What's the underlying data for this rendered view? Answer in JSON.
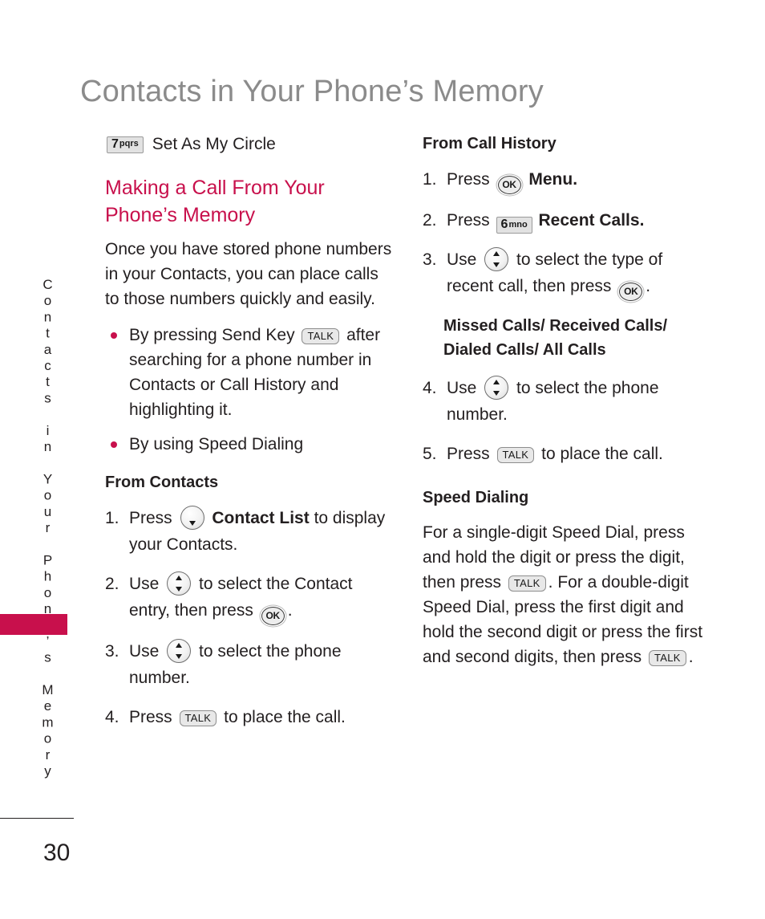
{
  "page": {
    "title": "Contacts in Your Phone’s Memory",
    "side_tab_text": "Contacts in Your Phone’s Memory",
    "folio": "30",
    "accent_color": "#c8104c",
    "title_color": "#8b8b8b",
    "text_color": "#231f20"
  },
  "left_column": {
    "menu_item": {
      "key_digit": "7",
      "key_letters": "pqrs",
      "label": "Set As My Circle"
    },
    "heading": "Making a Call From Your Phone’s Memory",
    "intro": "Once you have stored phone numbers in your Contacts, you can place calls to those numbers quickly and easily.",
    "bullets": [
      {
        "pre": "By pressing Send Key",
        "key": "TALK",
        "post": "after searching for a phone number in Contacts or Call History and highlighting it."
      },
      {
        "pre": "By using Speed Dialing",
        "key": "",
        "post": ""
      }
    ],
    "subhead": "From Contacts",
    "steps": [
      {
        "num": "1.",
        "pre": "Press",
        "key": "nav-down",
        "bold": "Contact List",
        "post": "to display your Contacts."
      },
      {
        "num": "2.",
        "pre": "Use",
        "key": "nav-updown",
        "bold": "",
        "post": "to select the Contact entry, then press",
        "key2": "OK",
        "tail": "."
      },
      {
        "num": "3.",
        "pre": "Use",
        "key": "nav-updown",
        "bold": "",
        "post": "to select the phone number."
      },
      {
        "num": "4.",
        "pre": "Press",
        "key": "TALK",
        "bold": "",
        "post": "to place the call."
      }
    ]
  },
  "right_column": {
    "subhead": "From Call History",
    "steps": [
      {
        "num": "1.",
        "pre": "Press",
        "key": "OK",
        "bold": "Menu",
        "tail": "."
      },
      {
        "num": "2.",
        "pre": "Press",
        "key_digit": "6",
        "key_letters": "mno",
        "bold": "Recent Calls",
        "tail": "."
      },
      {
        "num": "3.",
        "pre": "Use",
        "key": "nav-updown",
        "post": "to select the type of recent call, then press",
        "key2": "OK",
        "tail": "."
      }
    ],
    "call_types": "Missed Calls/ Received Calls/ Dialed Calls/ All Calls",
    "steps_cont": [
      {
        "num": "4.",
        "pre": "Use",
        "key": "nav-updown",
        "post": "to select the phone number."
      },
      {
        "num": "5.",
        "pre": "Press",
        "key": "TALK",
        "post": "to place the call."
      }
    ],
    "speed_subhead": "Speed Dialing",
    "speed_para_1": "For a single-digit Speed Dial, press and hold the digit or press the digit, then press",
    "speed_key_1": "TALK",
    "speed_para_2": ". For a double-digit Speed Dial, press the first digit and hold the second digit or press the first and second digits, then press",
    "speed_key_2": "TALK",
    "speed_para_3": "."
  }
}
